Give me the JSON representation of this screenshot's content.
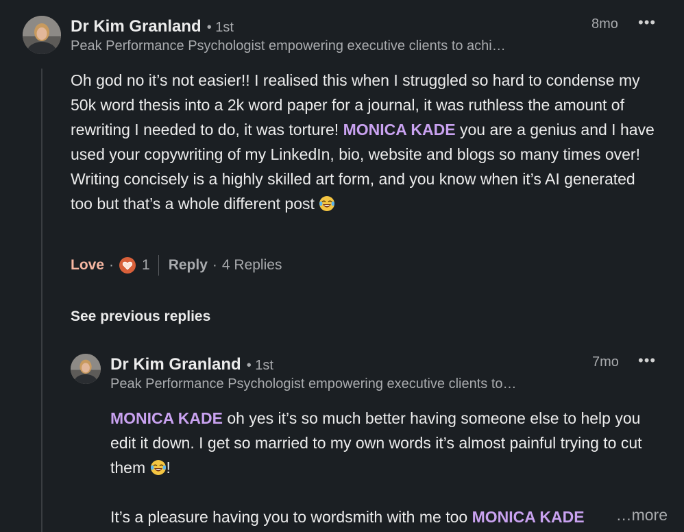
{
  "main_comment": {
    "author": "Dr Kim Granland",
    "degree": "• 1st",
    "headline": "Peak Performance Psychologist empowering executive clients to achi…",
    "time": "8mo",
    "more_icon": "more-horizontal-icon",
    "body": {
      "part1": "Oh god no it’s not easier!! I realised this when I struggled so hard to condense my 50k word thesis into a 2k word paper for a journal, it was ruthless the amount of rewriting I needed to do, it was torture! ",
      "mention": "MONICA KADE",
      "part2": " you are a genius and I have used your copywriting of my LinkedIn, bio, website and blogs so many times over! Writing concisely is a highly skilled art form, and you know when it’s AI generated too but that’s a whole different post ",
      "emoji": "tears-of-joy-emoji"
    },
    "actions": {
      "reaction_label": "Love",
      "reaction_icon": "love-heart-icon",
      "reaction_count": "1",
      "reply_label": "Reply",
      "replies_count": "4 Replies"
    }
  },
  "see_previous": "See previous replies",
  "reply_comment": {
    "author": "Dr Kim Granland",
    "degree": "• 1st",
    "headline": "Peak Performance Psychologist empowering executive clients to…",
    "time": "7mo",
    "more_icon": "more-horizontal-icon",
    "body": {
      "mention1": "MONICA KADE",
      "part1": " oh yes it’s so much better having someone else to help you edit it down. I get so married to my own words it’s almost painful trying to cut them ",
      "part1_end": "!",
      "part2": "It’s a pleasure having you to wordsmith with me too ",
      "mention2": "MONICA KADE",
      "see_more": "…more"
    }
  },
  "colors": {
    "background": "#1b1f23",
    "mention": "#c9a2f0",
    "love": "#f7b7a2",
    "secondary_text": "#a9abae"
  }
}
